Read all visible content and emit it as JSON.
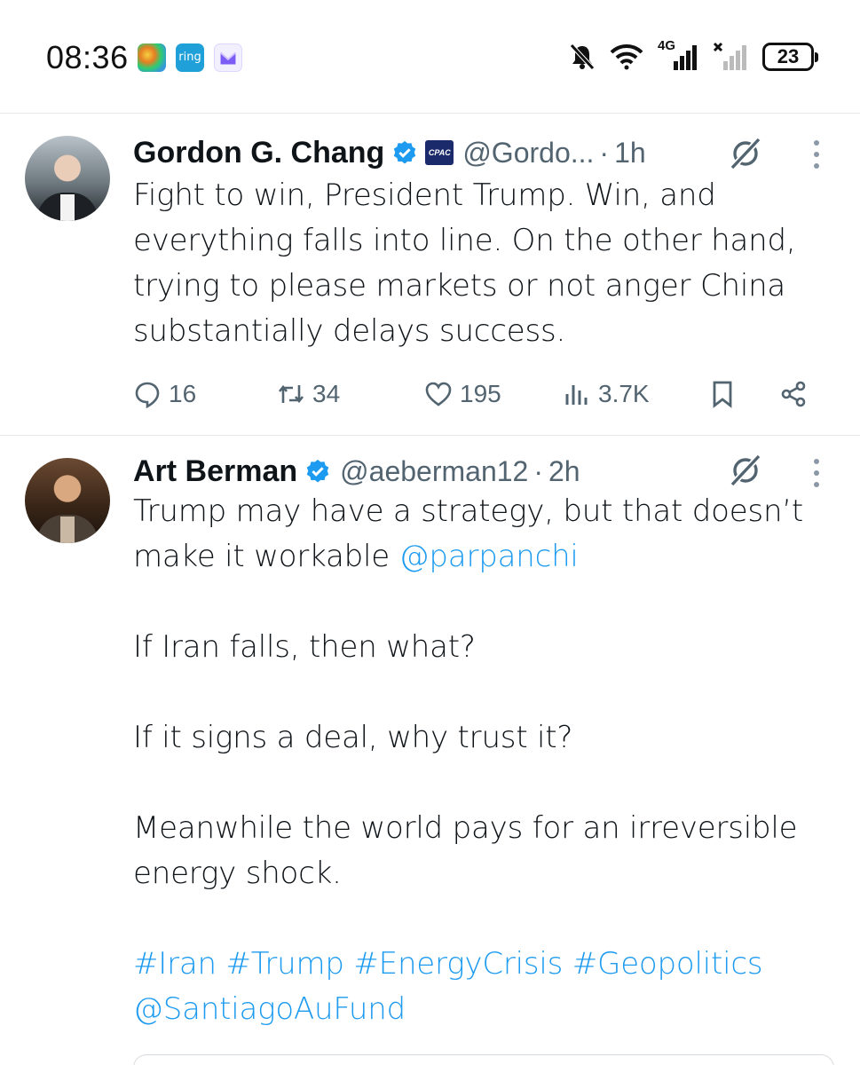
{
  "status_bar": {
    "time": "08:36",
    "app_icons": [
      "radar-app-icon",
      "ring-app-icon",
      "proton-mail-icon"
    ],
    "ring_label": "ring",
    "network_label": "4G",
    "battery": "23",
    "indicators": [
      "bell-muted-icon",
      "wifi-icon",
      "signal-4g-icon",
      "signal-no-service-icon",
      "battery-icon"
    ]
  },
  "tweets": [
    {
      "name": "Gordon G. Chang",
      "verified": true,
      "affiliation_badge": "CPAC",
      "handle": "@Gordo...",
      "time": "1h",
      "paragraphs": [
        "Fight to win, President Trump. Win, and everything falls into line. On the other hand, trying to please markets or not anger China substantially delays success."
      ],
      "actions": {
        "replies": "16",
        "retweets": "34",
        "likes": "195",
        "views": "3.7K"
      }
    },
    {
      "name": "Art Berman",
      "verified": true,
      "handle": "@aeberman12",
      "time": "2h",
      "p1_text": "Trump may have a strategy, but that doesn’t make it workable ",
      "p1_mention": "@parpanchi",
      "p2": "If Iran falls, then what?",
      "p3": "If it signs a deal, why trust it?",
      "p4": "Meanwhile the world pays for an irreversible energy shock.",
      "hashtags": "#Iran #Trump #EnergyCrisis #Geopolitics",
      "tag_mention": "@SantiagoAuFund"
    }
  ],
  "colors": {
    "link": "#1d9bf0",
    "secondary_text": "#536471",
    "primary_text": "#0f1419",
    "divider": "#e6e9ec"
  }
}
